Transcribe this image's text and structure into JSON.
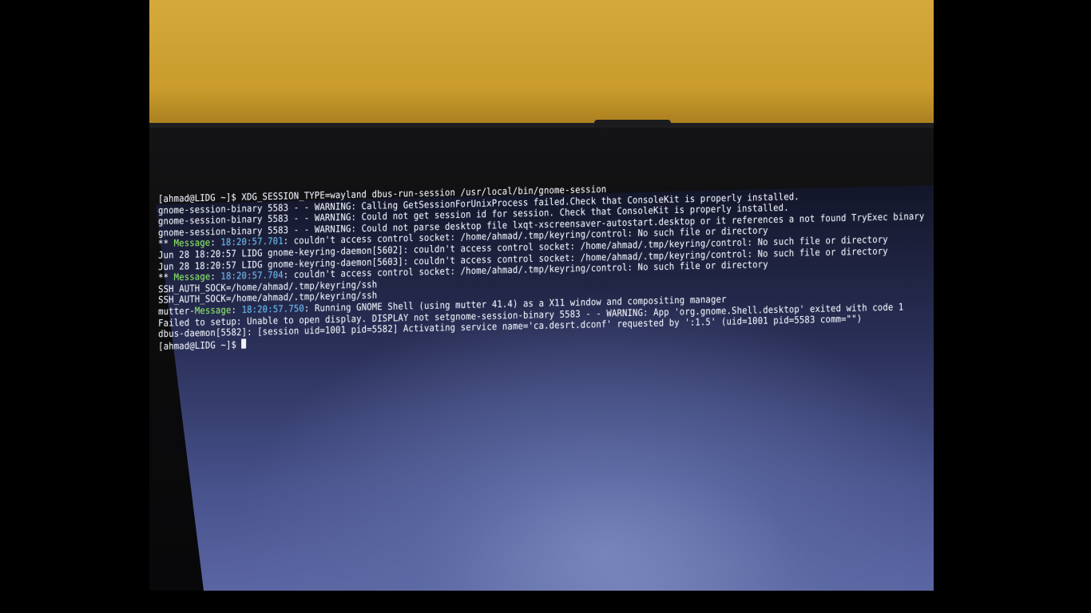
{
  "terminal": {
    "lines": [
      [
        {
          "t": "[ahmad@LIDG ~]$ XDG_SESSION_TYPE=wayland dbus-run-session /usr/local/bin/gnome-session"
        }
      ],
      [
        {
          "t": "gnome-session-binary 5583 - - WARNING: Calling GetSessionForUnixProcess failed.Check that ConsoleKit is properly installed."
        }
      ],
      [
        {
          "t": "gnome-session-binary 5583 - - WARNING: Could not get session id for session. Check that ConsoleKit is properly installed."
        }
      ],
      [
        {
          "t": "gnome-session-binary 5583 - - WARNING: Could not parse desktop file lxqt-xscreensaver-autostart.desktop or it references a not found TryExec binary"
        }
      ],
      [
        {
          "t": "** "
        },
        {
          "t": "Message",
          "c": "green"
        },
        {
          "t": ": "
        },
        {
          "t": "18:20:57.701",
          "c": "blue"
        },
        {
          "t": ": couldn't access control socket: /home/ahmad/.tmp/keyring/control: No such file or directory"
        }
      ],
      [
        {
          "t": "Jun 28 18:20:57 LIDG gnome-keyring-daemon[5602]: couldn't access control socket: /home/ahmad/.tmp/keyring/control: No such file or directory"
        }
      ],
      [
        {
          "t": "Jun 28 18:20:57 LIDG gnome-keyring-daemon[5603]: couldn't access control socket: /home/ahmad/.tmp/keyring/control: No such file or directory"
        }
      ],
      [
        {
          "t": "** "
        },
        {
          "t": "Message",
          "c": "green"
        },
        {
          "t": ": "
        },
        {
          "t": "18:20:57.704",
          "c": "blue"
        },
        {
          "t": ": couldn't access control socket: /home/ahmad/.tmp/keyring/control: No such file or directory"
        }
      ],
      [
        {
          "t": "SSH_AUTH_SOCK=/home/ahmad/.tmp/keyring/ssh"
        }
      ],
      [
        {
          "t": "SSH_AUTH_SOCK=/home/ahmad/.tmp/keyring/ssh"
        }
      ],
      [
        {
          "t": "mutter-"
        },
        {
          "t": "Message",
          "c": "green"
        },
        {
          "t": ": "
        },
        {
          "t": "18:20:57.750",
          "c": "blue"
        },
        {
          "t": ": Running GNOME Shell (using mutter 41.4) as a X11 window and compositing manager"
        }
      ],
      [
        {
          "t": "Failed to setup: Unable to open display. DISPLAY not setgnome-session-binary 5583 - - WARNING: App 'org.gnome.Shell.desktop' exited with code 1"
        }
      ],
      [
        {
          "t": "dbus-daemon[5582]: [session uid=1001 pid=5582] Activating service name='ca.desrt.dconf' requested by ':1.5' (uid=1001 pid=5583 comm=\"\")"
        }
      ],
      [
        {
          "t": "[ahmad@LIDG ~]$ "
        },
        {
          "cursor": true
        }
      ]
    ]
  },
  "colors": {
    "background": "#000000",
    "wall": "#d4a93a",
    "screen": "#4a548e",
    "text": "#e9ecf6",
    "message_green": "#7ee35a",
    "timestamp_blue": "#5cb2f2"
  }
}
